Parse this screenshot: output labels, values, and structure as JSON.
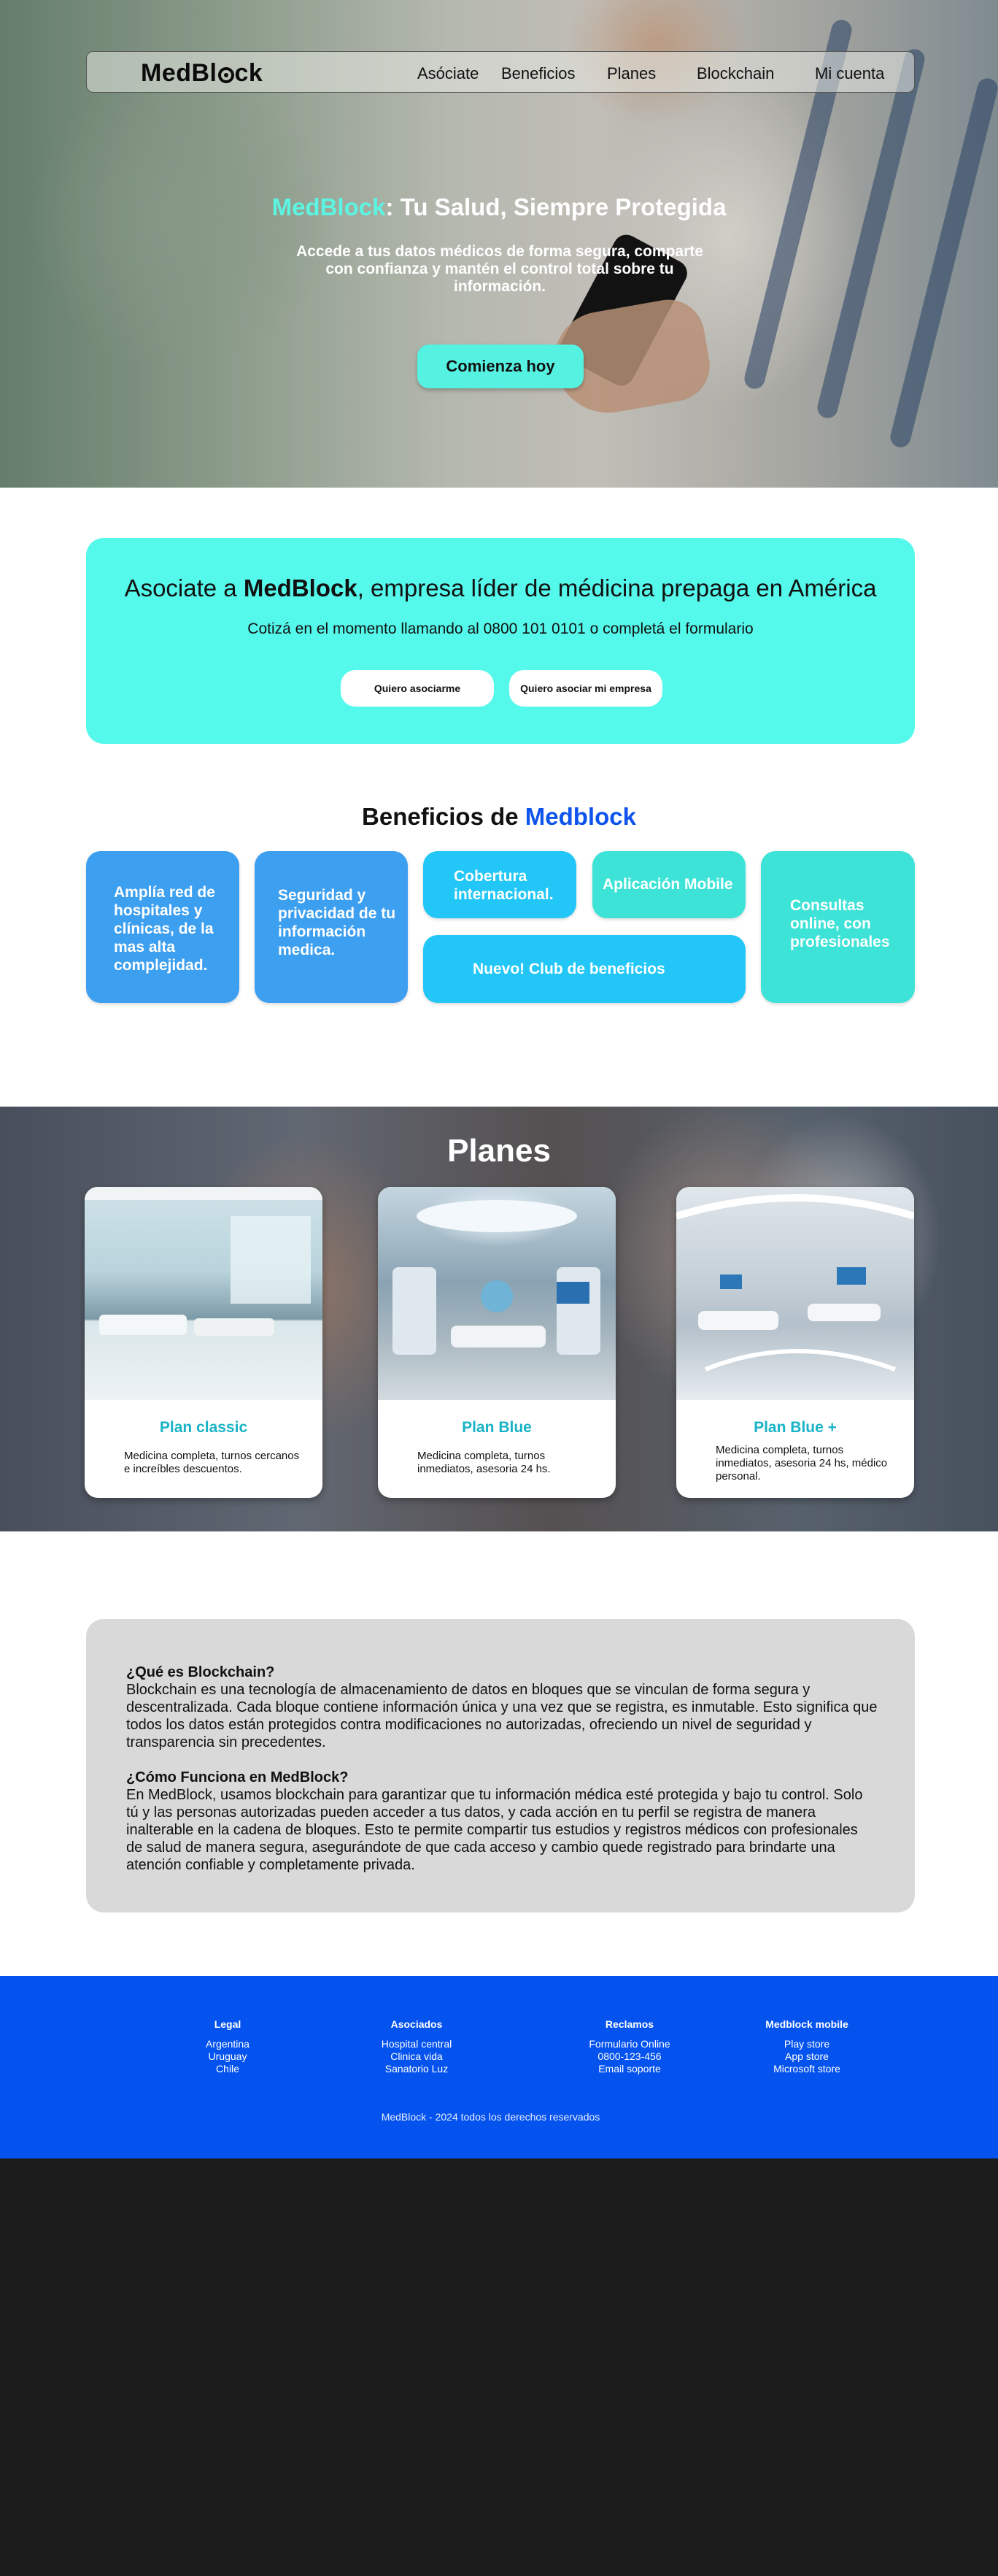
{
  "nav": {
    "logo_pre": "MedBl",
    "logo_post": "ck",
    "items": [
      "Asóciate",
      "Beneficios",
      "Planes",
      "Blockchain",
      "Mi cuenta"
    ]
  },
  "hero": {
    "title_brand": "MedBlock",
    "title_rest": ": Tu Salud, Siempre Protegida",
    "subtitle": "Accede a tus datos médicos de forma segura, comparte con confianza y mantén el control total sobre tu información.",
    "cta": "Comienza hoy"
  },
  "asociate": {
    "title_pre": "Asociate a ",
    "title_brand": "MedBlock",
    "title_post": ", empresa líder de médicina prepaga en América",
    "subtitle": "Cotizá en el momento llamando al 0800 101 0101 o completá el formulario",
    "btn_personal": "Quiero asociarme",
    "btn_empresa": "Quiero asociar mi empresa"
  },
  "beneficios": {
    "title_pre": "Beneficios de ",
    "title_brand": "Medblock",
    "cards": [
      "Amplía red de hospitales y clínicas, de la mas alta complejidad.",
      "Seguridad y privacidad de tu información medica.",
      "Cobertura internacional.",
      "Aplicación Mobile",
      "Consultas online, con profesionales",
      "Nuevo! Club de beneficios"
    ]
  },
  "planes": {
    "title": "Planes",
    "items": [
      {
        "name": "Plan classic",
        "desc": "Medicina completa, turnos cercanos e increíbles descuentos."
      },
      {
        "name": "Plan Blue",
        "desc": "Medicina completa, turnos inmediatos, asesoria 24 hs."
      },
      {
        "name": "Plan Blue +",
        "desc": "Medicina completa, turnos inmediatos, asesoria 24 hs, médico personal."
      }
    ]
  },
  "blockchain": {
    "q1": "¿Qué es Blockchain?",
    "a1": "Blockchain es una tecnología de almacenamiento de datos en bloques que se vinculan de forma segura y descentralizada. Cada bloque contiene información única y una vez que se registra, es inmutable. Esto significa que todos los datos están protegidos contra modificaciones no autorizadas, ofreciendo un nivel de seguridad y transparencia sin precedentes.",
    "q2": "¿Cómo Funciona en MedBlock?",
    "a2": "En MedBlock, usamos blockchain para garantizar que tu información médica esté protegida y bajo tu control. Solo tú y las personas autorizadas pueden acceder a tus datos, y cada acción en tu perfil se registra de manera inalterable en la cadena de bloques. Esto te permite compartir tus estudios y registros médicos con profesionales de salud de manera segura, asegurándote de que cada acceso y cambio quede registrado para brindarte una atención confiable y completamente privada."
  },
  "footer": {
    "cols": [
      {
        "title": "Legal",
        "links": [
          "Argentina",
          "Uruguay",
          "Chile"
        ]
      },
      {
        "title": "Asociados",
        "links": [
          "Hospital central",
          "Clinica vida",
          "Sanatorio Luz"
        ]
      },
      {
        "title": "Reclamos",
        "links": [
          "Formulario Online",
          "0800-123-456",
          "Email soporte"
        ]
      },
      {
        "title": "Medblock mobile",
        "links": [
          "Play store",
          "App store",
          "Microsoft store"
        ]
      }
    ],
    "copyright": "MedBlock - 2024 todos los derechos reservados"
  },
  "colors": {
    "accent_cyan": "#55f9eb",
    "brand_blue": "#0d53ec",
    "card_blue": "#3d9ff0",
    "card_sky": "#22c7f7",
    "card_teal": "#3ee3d7",
    "plan_title": "#19b3c7",
    "footer_bg": "#0553ee",
    "bottom_bg": "#1b1b1b"
  }
}
